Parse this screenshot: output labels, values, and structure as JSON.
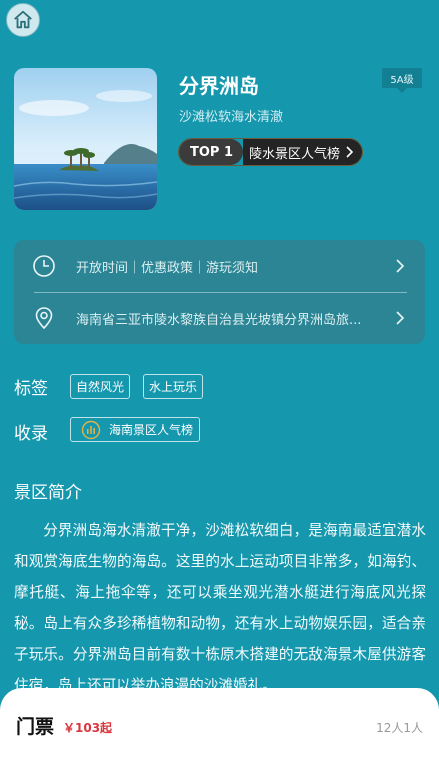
{
  "nav": {
    "home_icon": "home-icon"
  },
  "spot": {
    "name": "分界洲岛",
    "level": "5A级",
    "slogan": "沙滩松软海水清澈",
    "rank_top": "TOP 1",
    "rank_label": "陵水景区人气榜"
  },
  "info": {
    "hours": "开放时间｜优惠政策｜游玩须知",
    "address": "海南省三亚市陵水黎族自治县光坡镇分界洲岛旅..."
  },
  "tags": {
    "label": "标签",
    "items": [
      "自然风光",
      "水上玩乐"
    ]
  },
  "collection": {
    "label": "收录",
    "item": "海南景区人气榜"
  },
  "intro": {
    "title": "景区简介",
    "text": "分界洲岛海水清澈干净，沙滩松软细白，是海南最适宜潜水和观赏海底生物的海岛。这里的水上运动项目非常多，如海钓、摩托艇、海上拖伞等，还可以乘坐观光潜水艇进行海底风光探秘。岛上有众多珍稀植物和动物，还有水上动物娱乐园，适合亲子玩乐。分界洲岛目前有数十栋原木搭建的无敌海景木屋供游客住宿，岛上还可以举办浪漫的沙滩婚礼。"
  },
  "ticket": {
    "title": "门票",
    "price": "￥103起",
    "people": "12人1人"
  },
  "colors": {
    "background": "#1597ad",
    "card": "#2b8594",
    "price": "#d9363e"
  }
}
